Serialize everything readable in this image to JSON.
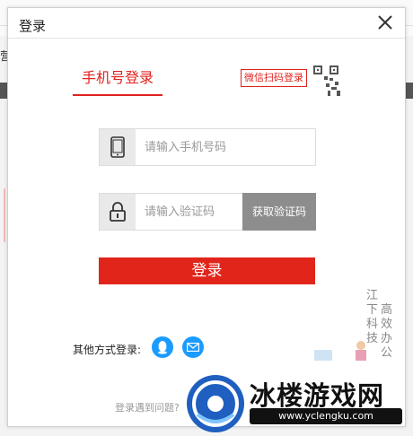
{
  "background": {
    "left_text": "营"
  },
  "modal": {
    "title": "登录",
    "tabs": {
      "phone": "手机号登录",
      "wechat": "微信扫码登录"
    },
    "phone_field": {
      "placeholder": "请输入手机号码",
      "icon": "phone-icon"
    },
    "code_field": {
      "placeholder": "请输入验证码",
      "icon": "lock-icon",
      "button": "获取验证码"
    },
    "login_button": "登录",
    "other_methods": {
      "label": "其他方式登录:",
      "qq_icon": "qq-icon",
      "mail_icon": "mail-icon"
    },
    "help_link": "登录遇到问题?"
  },
  "side": {
    "col1": "江下科技",
    "col2": "高效办公"
  },
  "watermark": {
    "title": "冰楼游戏网",
    "url": "www.yclengku.com"
  },
  "colors": {
    "accent": "#e1251b",
    "button_gray": "#8d8d8d",
    "social_blue": "#1a9bff"
  }
}
